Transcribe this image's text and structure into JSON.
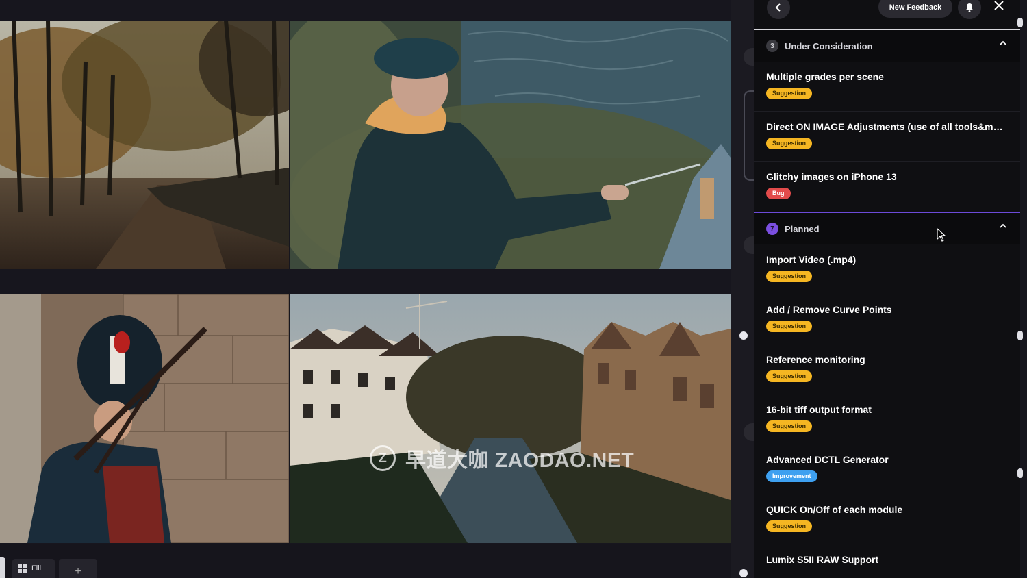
{
  "header": {
    "back_icon": "chevron-left-icon",
    "new_feedback_label": "New Feedback",
    "bell_icon": "bell-icon",
    "close_icon": "close-icon"
  },
  "sections": [
    {
      "count": "3",
      "title": "Under Consideration",
      "color": "#8a8a92",
      "items": [
        {
          "title": "Multiple grades per scene",
          "tag": "Suggestion",
          "type": "suggestion"
        },
        {
          "title": "Direct ON IMAGE Adjustments (use of all tools&mod...",
          "tag": "Suggestion",
          "type": "suggestion"
        },
        {
          "title": "Glitchy images on iPhone 13",
          "tag": "Bug",
          "type": "bug"
        }
      ]
    },
    {
      "count": "7",
      "title": "Planned",
      "color": "#7b4fe0",
      "items": [
        {
          "title": "Import Video (.mp4)",
          "tag": "Suggestion",
          "type": "suggestion"
        },
        {
          "title": "Add / Remove Curve Points",
          "tag": "Suggestion",
          "type": "suggestion"
        },
        {
          "title": "Reference monitoring",
          "tag": "Suggestion",
          "type": "suggestion"
        },
        {
          "title": "16-bit tiff output format",
          "tag": "Suggestion",
          "type": "suggestion"
        },
        {
          "title": "Advanced DCTL Generator",
          "tag": "Improvement",
          "type": "improvement"
        },
        {
          "title": "QUICK On/Off of each module",
          "tag": "Suggestion",
          "type": "suggestion"
        },
        {
          "title": "Lumix S5II RAW Support",
          "tag": "",
          "type": ""
        }
      ]
    }
  ],
  "bottom_bar": {
    "fill_label": "Fill",
    "add_label": "+"
  },
  "watermark": {
    "logo_letter": "Z",
    "text": "早道大咖  ZAODAO.NET"
  },
  "colors": {
    "suggestion": "#f5b622",
    "bug": "#e24b4b",
    "improvement": "#3ea0f0",
    "planned_accent": "#6c4ad8"
  }
}
